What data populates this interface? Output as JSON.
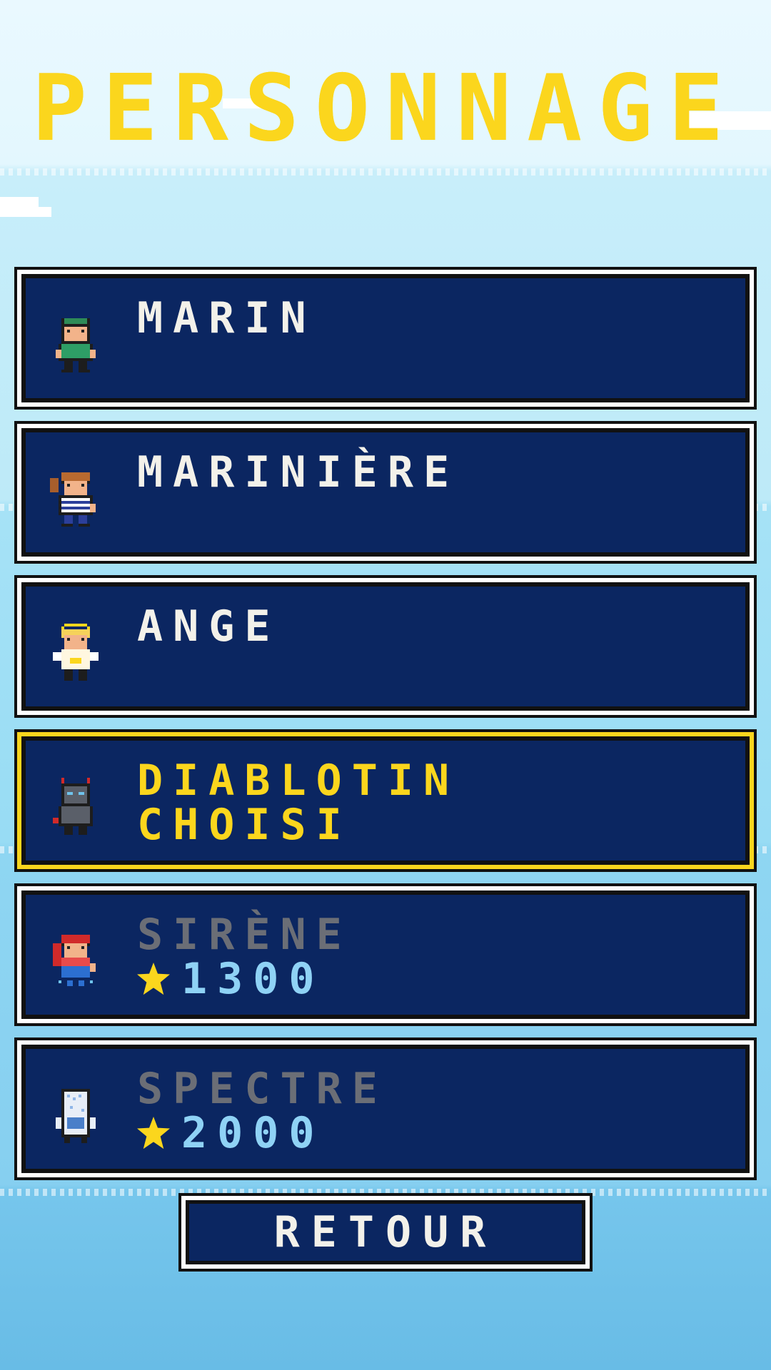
{
  "screen": {
    "title": "PERSONNAGE"
  },
  "characters": [
    {
      "name": "MARIN",
      "status": "",
      "price": "",
      "icon": "sailor-boy-sprite-icon"
    },
    {
      "name": "MARINIÈRE",
      "status": "",
      "price": "",
      "icon": "sailor-girl-sprite-icon"
    },
    {
      "name": "ANGE",
      "status": "",
      "price": "",
      "icon": "angel-sprite-icon"
    },
    {
      "name": "DIABLOTIN",
      "status": "CHOISI",
      "price": "",
      "icon": "imp-sprite-icon"
    },
    {
      "name": "SIRÈNE",
      "status": "",
      "price": "1300",
      "icon": "mermaid-sprite-icon"
    },
    {
      "name": "SPECTRE",
      "status": "",
      "price": "2000",
      "icon": "ghost-sprite-icon"
    }
  ],
  "back_button": {
    "label": "RETOUR"
  },
  "colors": {
    "title": "#fbd61d",
    "card_bg": "#0b2661",
    "selected_border": "#fbd61d",
    "locked_text": "#6b6e76",
    "price_text": "#8fd2f5"
  }
}
